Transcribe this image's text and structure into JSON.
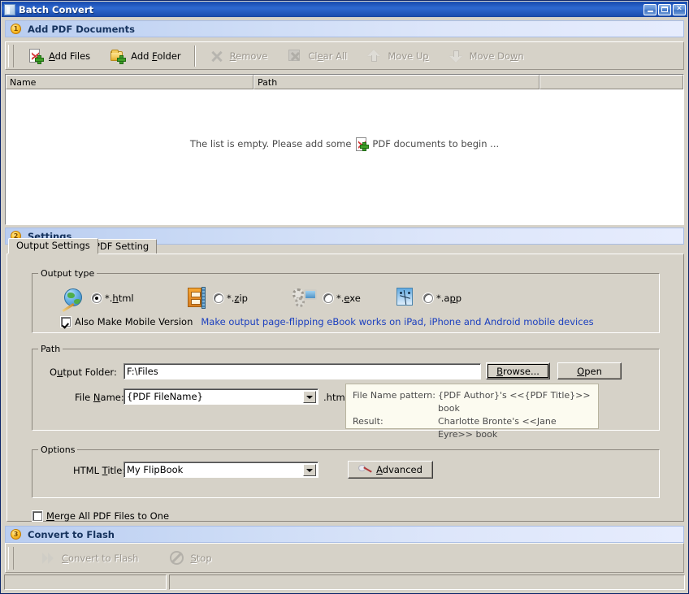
{
  "window": {
    "title": "Batch Convert",
    "icon": "window-icon",
    "controls": {
      "minimize": "minimize",
      "maximize": "maximize",
      "close": "close"
    }
  },
  "step1": {
    "number": "1",
    "label": "Add PDF Documents",
    "toolbar": [
      {
        "name": "add-files",
        "label": "Add Files",
        "icon": "pdf-add-icon",
        "enabled": true
      },
      {
        "name": "add-folder",
        "label": "Add Folder",
        "icon": "folder-add-icon",
        "enabled": true
      },
      {
        "name": "remove",
        "label": "Remove",
        "icon": "remove-icon",
        "enabled": false
      },
      {
        "name": "clear-all",
        "label": "Clear All",
        "icon": "clear-all-icon",
        "enabled": false
      },
      {
        "name": "move-up",
        "label": "Move Up",
        "icon": "arrow-up-icon",
        "enabled": false
      },
      {
        "name": "move-down",
        "label": "Move Down",
        "icon": "arrow-down-icon",
        "enabled": false
      }
    ],
    "list": {
      "columns": [
        "Name",
        "Path",
        ""
      ],
      "rows": [],
      "empty_prefix": "The list is empty. Please add some",
      "empty_suffix": "PDF documents to begin ...",
      "empty_icon": "pdf-add-icon"
    }
  },
  "step2": {
    "number": "2",
    "label": "Settings",
    "tabs": [
      {
        "name": "output-settings",
        "label": "Output Settings",
        "active": true
      },
      {
        "name": "pdf-setting",
        "label": "PDF Setting",
        "active": false
      }
    ],
    "output_type": {
      "legend": "Output type",
      "options": [
        {
          "name": "html",
          "label": "*.html",
          "icon": "globe-icon",
          "selected": true
        },
        {
          "name": "zip",
          "label": "*.zip",
          "icon": "zip-icon",
          "selected": false
        },
        {
          "name": "exe",
          "label": "*.exe",
          "icon": "exe-icon",
          "selected": false
        },
        {
          "name": "app",
          "label": "*.app",
          "icon": "mac-app-icon",
          "selected": false
        }
      ],
      "mobile_checkbox": {
        "label": "Also Make Mobile Version",
        "checked": true
      },
      "mobile_note": "Make output page-flipping eBook works on iPad, iPhone and Android mobile devices"
    },
    "path": {
      "legend": "Path",
      "output_folder_label": "Output Folder:",
      "output_folder_value": "F:\\Files",
      "browse_label": "Browse...",
      "open_label": "Open",
      "file_name_label": "File Name:",
      "file_name_value": "{PDF FileName}",
      "file_name_extension": ".html",
      "pattern_label": "File Name pattern:",
      "pattern_value": "{PDF Author}'s <<{PDF Title}>> book",
      "result_label": "Result:",
      "result_value": "Charlotte Bronte's <<Jane Eyre>> book"
    },
    "options": {
      "legend": "Options",
      "html_title_label": "HTML Title:",
      "html_title_value": "My FlipBook",
      "advanced_label": "Advanced",
      "advanced_icon": "wand-icon",
      "merge_checkbox": {
        "label": "Merge All PDF Files to One",
        "checked": false
      }
    }
  },
  "step3": {
    "number": "3",
    "label": "Convert to Flash",
    "toolbar": [
      {
        "name": "convert-to-flash",
        "label": "Convert to Flash",
        "icon": "play-icon",
        "enabled": false
      },
      {
        "name": "stop",
        "label": "Stop",
        "icon": "stop-icon",
        "enabled": false
      }
    ]
  },
  "statusbar": {
    "left": "",
    "right": ""
  },
  "colors": {
    "titlebar": "#1d51b5",
    "face": "#d6d2c8",
    "band": "#cddcf6",
    "link": "#1b3fbf",
    "info_bg": "#fcfbf0"
  }
}
